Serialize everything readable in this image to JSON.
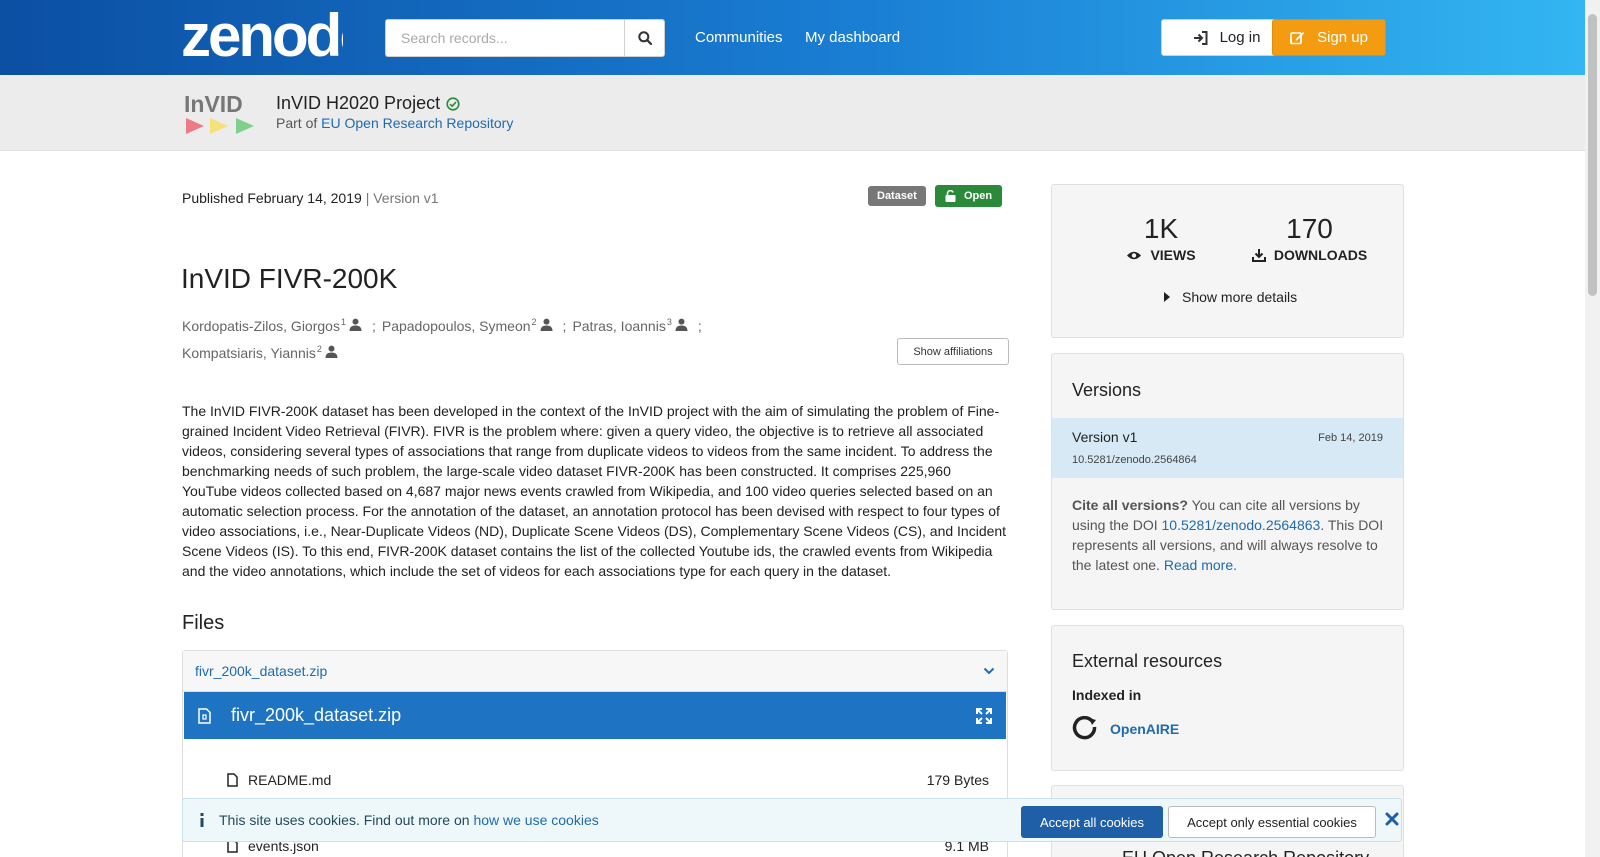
{
  "header": {
    "logo_text": "zenodo",
    "search_placeholder": "Search records...",
    "nav": [
      "Communities",
      "My dashboard"
    ],
    "login_label": "Log in",
    "signup_label": "Sign up"
  },
  "community": {
    "logo_text": "InVID",
    "title": "InVID H2020 Project",
    "part_of_prefix": "Part of",
    "parent": "EU Open Research Repository"
  },
  "record": {
    "published": "Published February 14, 2019",
    "version": "| Version v1",
    "badge_type": "Dataset",
    "badge_access": "Open",
    "title": "InVID FIVR-200K",
    "creators": [
      {
        "name": "Kordopatis-Zilos, Giorgos",
        "aff": "1",
        "sep": ";"
      },
      {
        "name": "Papadopoulos, Symeon",
        "aff": "2",
        "sep": ";"
      },
      {
        "name": "Patras, Ioannis",
        "aff": "3",
        "sep": ";"
      },
      {
        "name": "Kompatsiaris, Yiannis",
        "aff": "2",
        "sep": ""
      }
    ],
    "show_affiliations": "Show affiliations",
    "description": "The InVID FIVR-200K dataset has been developed in the context of the InVID project with the aim of simulating the problem of Fine-grained Incident Video Retrieval (FIVR). FIVR is the problem where: given a query video, the objective is to retrieve all associated videos, considering several types of associations that range from duplicate videos to videos from the same incident. To address the benchmarking needs of such problem, the large-scale video dataset FIVR-200K has been constructed. It comprises 225,960 YouTube videos collected based on 4,687 major news events crawled from Wikipedia, and 100 video queries selected based on an automatic selection process. For the annotation of the dataset, an annotation protocol has been devised with respect to four types of video associations, i.e., Near-Duplicate Videos (ND), Duplicate Scene Videos (DS), Complementary Scene Videos (CS), and Incident Scene Videos (IS). To this end, FIVR-200K dataset contains the list of the collected Youtube ids, the crawled events from Wikipedia and the video annotations, which include the set of videos for each associations type for each query in the dataset."
  },
  "files": {
    "heading": "Files",
    "archive_name": "fivr_200k_dataset.zip",
    "preview_title": "fivr_200k_dataset.zip",
    "entries": [
      {
        "name": "README.md",
        "size": "179 Bytes"
      },
      {
        "name": "events.json",
        "size": "9.1 MB"
      }
    ]
  },
  "stats": {
    "views": "1K",
    "views_label": "VIEWS",
    "downloads": "170",
    "downloads_label": "DOWNLOADS",
    "more": "Show more details"
  },
  "versions": {
    "heading": "Versions",
    "current_label": "Version v1",
    "current_date": "Feb 14, 2019",
    "current_doi": "10.5281/zenodo.2564864",
    "cite_bold": "Cite all versions?",
    "cite_text_1": "You can cite all versions by using the DOI",
    "cite_doi": "10.5281/zenodo.2564863",
    "cite_text_2": ". This DOI represents all versions, and will always resolve to the latest one.",
    "read_more": "Read more."
  },
  "external": {
    "heading": "External resources",
    "indexed_in": "Indexed in",
    "openaire": "OpenAIRE"
  },
  "card4_title": "EU Open Research Repository",
  "cookie": {
    "message": "This site uses cookies. Find out more on",
    "link": "how we use cookies",
    "accept_all": "Accept all cookies",
    "accept_essential": "Accept only essential cookies"
  },
  "colors": {
    "header_start": "#0b4fa3",
    "header_end": "#33b6f2",
    "signup": "#f39c12",
    "open_badge": "#2a8a3a",
    "file_bar": "#1e74c3",
    "link": "#1e6bb0"
  }
}
